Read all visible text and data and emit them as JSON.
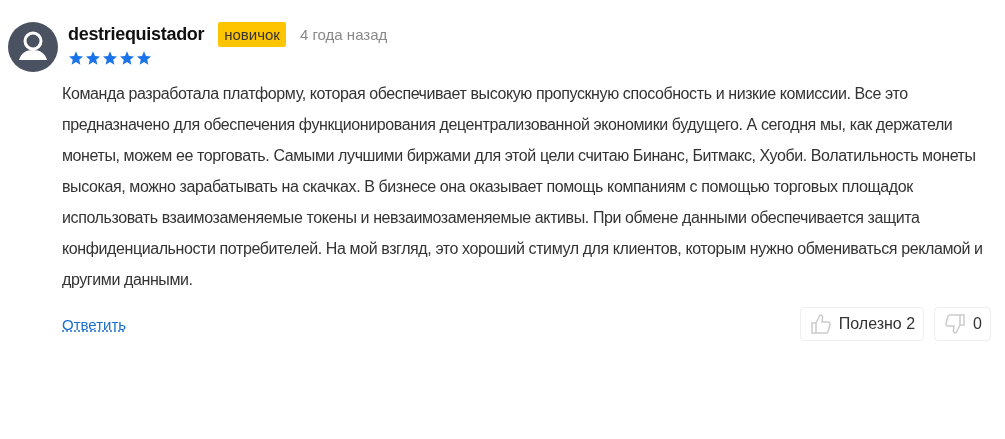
{
  "review": {
    "author": "destriequistador",
    "badge": "новичок",
    "time": "4 года назад",
    "stars": 5,
    "text": "Команда разработала платформу, которая обеспечивает высокую пропускную способность и низкие комиссии. Все это предназначено для обеспечения функционирования децентрализованной экономики будущего. А сегодня мы, как держатели монеты, можем ее торговать. Самыми лучшими биржами для этой цели считаю Бинанс, Битмакс, Хуоби. Волатильность монеты высокая, можно зарабатывать на скачках. В бизнесе она оказывает помощь компаниям с помощью торговых площадок использовать взаимозаменяемые токены и невзаимозаменяемые активы. При обмене данными обеспечивается защита конфиденциальности потребителей. На мой взгляд, это хороший стимул для клиентов, которым нужно обмениваться рекламой и другими данными.",
    "reply": "Ответить",
    "helpful": "Полезно 2",
    "unhelpful": "0"
  }
}
